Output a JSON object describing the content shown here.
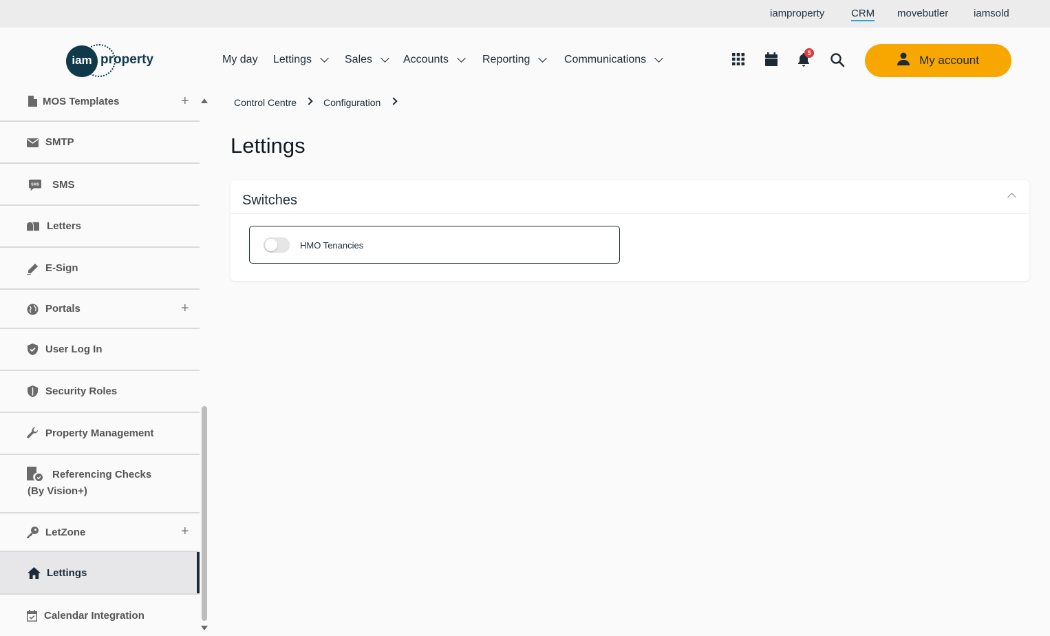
{
  "top_links": [
    {
      "label": "iamproperty",
      "active": false
    },
    {
      "label": "CRM",
      "active": true
    },
    {
      "label": "movebutler",
      "active": false
    },
    {
      "label": "iamsold",
      "active": false
    }
  ],
  "logo": {
    "mark": "iam",
    "text": "property"
  },
  "nav": [
    {
      "label": "My day",
      "dropdown": false
    },
    {
      "label": "Lettings",
      "dropdown": true
    },
    {
      "label": "Sales",
      "dropdown": true
    },
    {
      "label": "Accounts",
      "dropdown": true
    },
    {
      "label": "Reporting",
      "dropdown": true
    },
    {
      "label": "Communications",
      "dropdown": true
    }
  ],
  "header_icons": [
    "apps-grid-icon",
    "calendar-icon",
    "bell-icon",
    "search-icon"
  ],
  "notifications": {
    "count": "5"
  },
  "account": {
    "label": "My account",
    "icon": "user-icon"
  },
  "sidebar": {
    "items": [
      {
        "label": "MOS Templates",
        "icon": "document-icon",
        "expandable": true
      },
      {
        "label": "SMTP",
        "icon": "envelope-icon",
        "expandable": false
      },
      {
        "label": "SMS",
        "icon": "sms-chat-icon",
        "expandable": false
      },
      {
        "label": "Letters",
        "icon": "mailbox-icon",
        "expandable": false
      },
      {
        "label": "E-Sign",
        "icon": "pen-icon",
        "expandable": false
      },
      {
        "label": "Portals",
        "icon": "globe-icon",
        "expandable": true
      },
      {
        "label": "User Log In",
        "icon": "shield-check-icon",
        "expandable": false
      },
      {
        "label": "Security Roles",
        "icon": "shield-icon",
        "expandable": false
      },
      {
        "label": "Property Management",
        "icon": "wrench-icon",
        "expandable": false
      },
      {
        "label": "Referencing Checks (By Vision+)",
        "label_line1": "Referencing Checks",
        "label_line2": "(By Vision+)",
        "icon": "document-check-icon",
        "expandable": false
      },
      {
        "label": "LetZone",
        "icon": "key-icon",
        "expandable": true
      },
      {
        "label": "Lettings",
        "icon": "home-icon",
        "expandable": false,
        "active": true
      },
      {
        "label": "Calendar Integration",
        "icon": "calendar-check-icon",
        "expandable": false
      }
    ]
  },
  "breadcrumb": [
    "Control Centre",
    "Configuration"
  ],
  "page": {
    "title": "Lettings"
  },
  "switches_panel": {
    "title": "Switches",
    "items": [
      {
        "label": "HMO Tenancies",
        "enabled": false
      }
    ]
  }
}
